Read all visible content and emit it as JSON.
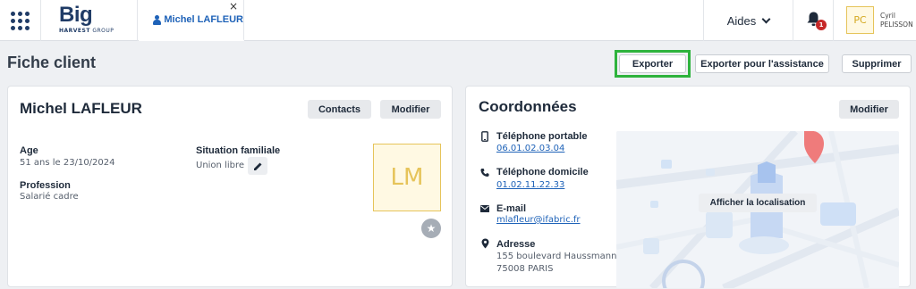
{
  "topbar": {
    "apps_icon": "apps-grid-icon",
    "logo": {
      "main": "Big",
      "sub_bold": "HARVEST",
      "sub": " GROUP"
    },
    "client_tab": {
      "label": "Michel LAFLEUR",
      "close": "×"
    },
    "aides_label": "Aides",
    "notifications_count": "1",
    "user": {
      "initials": "PC",
      "first_name": "Cyril",
      "last_name": "PELISSON"
    }
  },
  "page": {
    "title": "Fiche client",
    "actions": {
      "export": "Exporter",
      "export_assist": "Exporter pour l'assistance",
      "delete": "Supprimer"
    }
  },
  "client_card": {
    "name": "Michel LAFLEUR",
    "contacts_btn": "Contacts",
    "modify_btn": "Modifier",
    "age_label": "Age",
    "age_value": "51 ans le 23/10/2024",
    "situation_label": "Situation familiale",
    "situation_value": "Union libre",
    "profession_label": "Profession",
    "profession_value": "Salarié cadre",
    "avatar_initials": "LM"
  },
  "coord_card": {
    "title": "Coordonnées",
    "modify_btn": "Modifier",
    "mobile_label": "Téléphone portable",
    "mobile_value": "06.01.02.03.04",
    "home_label": "Téléphone domicile",
    "home_value": "01.02.11.22.33",
    "email_label": "E-mail",
    "email_value": "mlafleur@ifabric.fr",
    "address_label": "Adresse",
    "address_line1": "155 boulevard Haussmann",
    "address_line2": "75008 PARIS",
    "map_btn": "Afficher la localisation"
  },
  "colors": {
    "brand": "#1f3b66",
    "link": "#1e62b8",
    "highlight": "#2eb33d",
    "avatar_border": "#e6c45a"
  }
}
